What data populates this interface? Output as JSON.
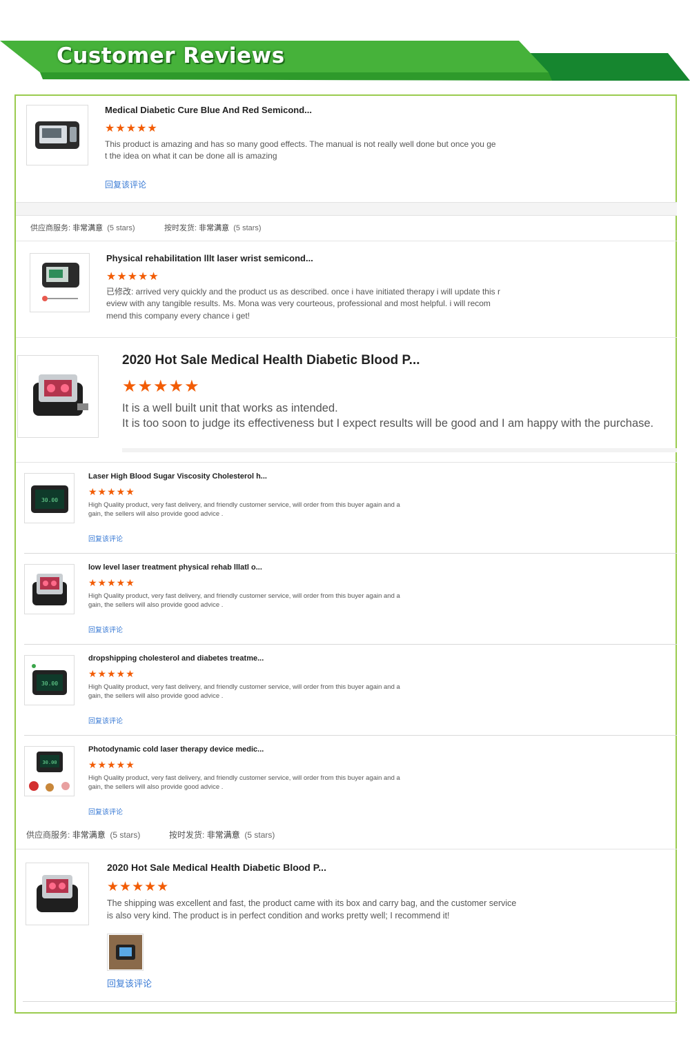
{
  "header": {
    "title": "Customer Reviews"
  },
  "colors": {
    "banner_light": "#46b23a",
    "banner_dark": "#16862f",
    "frame": "#9acb4e",
    "star": "#f25c05",
    "link": "#3a7bd5"
  },
  "star_glyphs": "★★★★★",
  "reviews": [
    {
      "title": "Medical Diabetic Cure Blue And Red Semicond...",
      "rating": 5,
      "text_lines": [
        "This product is amazing and has so many good effects.  The manual is not really well done but once you ge",
        "t the idea on what it can be done all is amazing"
      ],
      "reply": "回复该评论"
    },
    {
      "title": "Physical rehabilitation lllt laser wrist semicond...",
      "rating": 5,
      "text_lines": [
        "已修改: arrived very quickly and the product us as described. once i have initiated therapy i will update this r",
        "eview with any tangible results. Ms. Mona was very courteous, professional and most helpful. i will recom",
        "mend this company every chance i get!"
      ]
    },
    {
      "title": "2020 Hot Sale Medical Health Diabetic Blood P...",
      "rating": 5,
      "text_lines": [
        "It is a well built unit that works as intended.",
        "It is too soon to judge its effectiveness but I expect results will be good and I am happy with the purchase."
      ]
    },
    {
      "title": "Laser High Blood Sugar Viscosity Cholesterol h...",
      "rating": 5,
      "text_lines": [
        "High Quality product, very fast delivery, and friendly customer service, will order from this buyer again and a",
        "gain, the sellers will also provide good advice ."
      ],
      "reply": "回复该评论"
    },
    {
      "title": "low level laser treatment physical rehab lllatl o...",
      "rating": 5,
      "text_lines": [
        "High Quality product, very fast delivery, and friendly customer service, will order from this buyer again and a",
        "gain, the sellers will also provide good advice ."
      ],
      "reply": "回复该评论"
    },
    {
      "title": "dropshipping cholesterol and diabetes treatme...",
      "rating": 5,
      "text_lines": [
        "High Quality product, very fast delivery, and friendly customer service, will order from this buyer again and a",
        "gain, the sellers will also provide good advice ."
      ],
      "reply": "回复该评论"
    },
    {
      "title": "Photodynamic cold laser therapy device medic...",
      "rating": 5,
      "text_lines": [
        "High Quality product, very fast delivery, and friendly customer service, will order from this buyer again and a",
        "gain, the sellers will also provide good advice ."
      ],
      "reply": "回复该评论"
    },
    {
      "title": "2020 Hot Sale Medical Health Diabetic Blood P...",
      "rating": 5,
      "text_lines": [
        "The shipping was excellent and fast, the product came with its box and carry bag, and the customer service",
        "is also very kind. The product is in perfect condition and works pretty well; I recommend it!"
      ],
      "reply": "回复该评论"
    }
  ],
  "seller_ratings": {
    "service_label": "供应商服务:",
    "service_value": "非常满意",
    "service_stars": "(5 stars)",
    "shipping_label": "按时发货:",
    "shipping_value": "非常满意",
    "shipping_stars": "(5 stars)"
  },
  "device_screen_text": "30.00"
}
